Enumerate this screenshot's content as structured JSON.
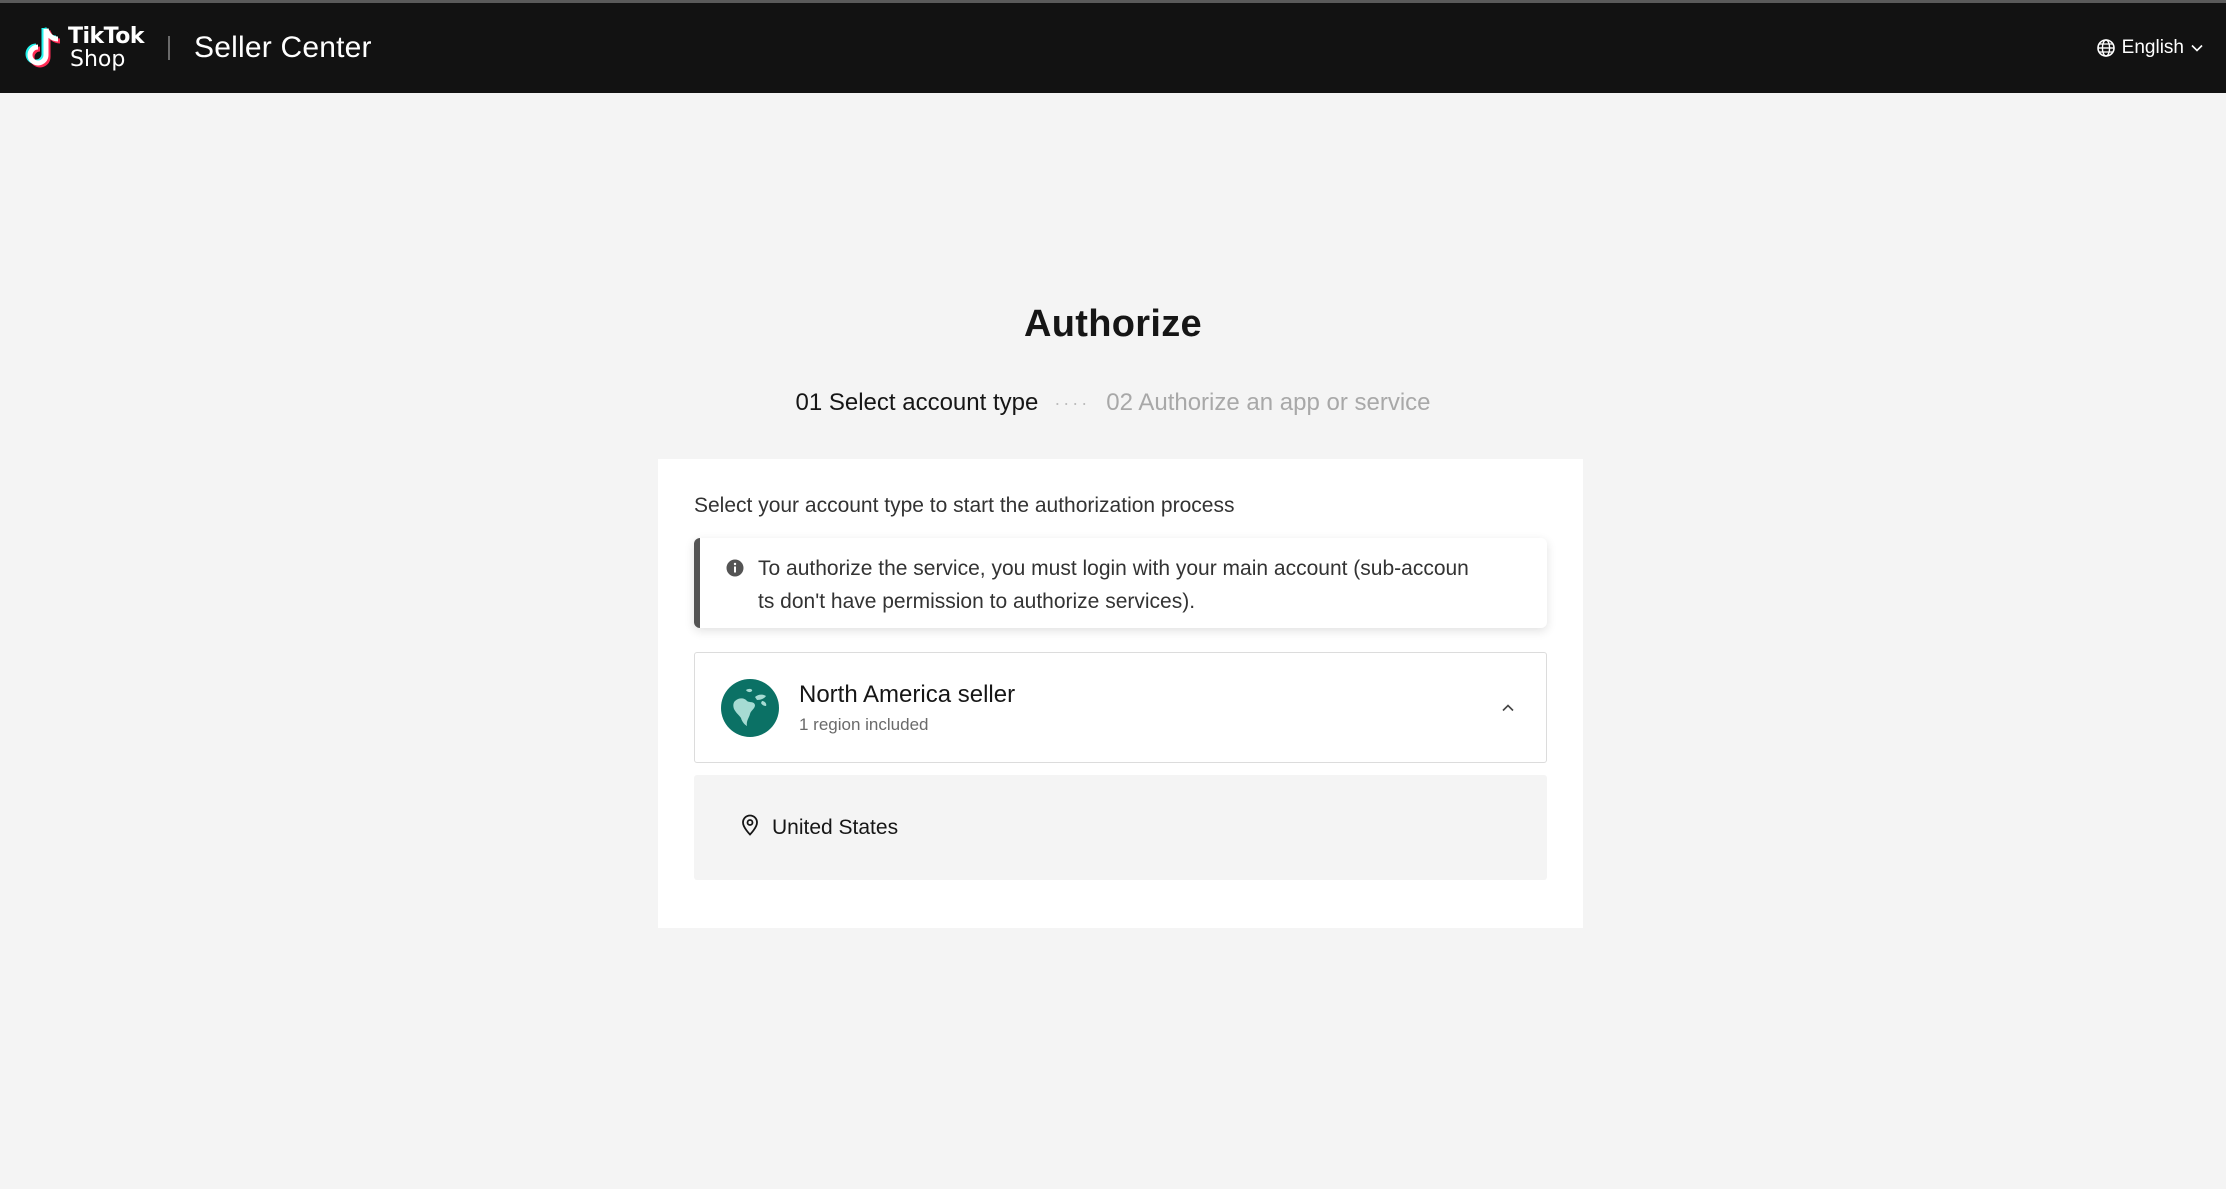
{
  "header": {
    "logo_line1": "TikTok",
    "logo_line2": "Shop",
    "app_title": "Seller Center",
    "language": "English",
    "globe_icon": "globe-icon",
    "chevron_icon": "chevron-down-icon"
  },
  "page": {
    "title": "Authorize",
    "steps": [
      {
        "label": "01 Select account type",
        "active": true
      },
      {
        "label": "02 Authorize an app or service",
        "active": false
      }
    ],
    "step_separator": "····"
  },
  "card": {
    "subtitle": "Select your account type to start the authorization process",
    "notice": {
      "icon": "info-icon",
      "line1": "To authorize the service, you must login with your main account (sub-accoun",
      "line2": "ts don't have permission to authorize services)."
    },
    "account_types": [
      {
        "name": "North America seller",
        "meta": "1 region included",
        "icon": "north-america-globe-icon",
        "expanded": true,
        "regions": [
          {
            "name": "United States",
            "icon": "location-pin-icon"
          }
        ]
      }
    ]
  },
  "colors": {
    "header_bg": "#121212",
    "page_bg": "#f4f4f4",
    "globe_teal": "#0b7165",
    "notice_border": "#545454"
  }
}
